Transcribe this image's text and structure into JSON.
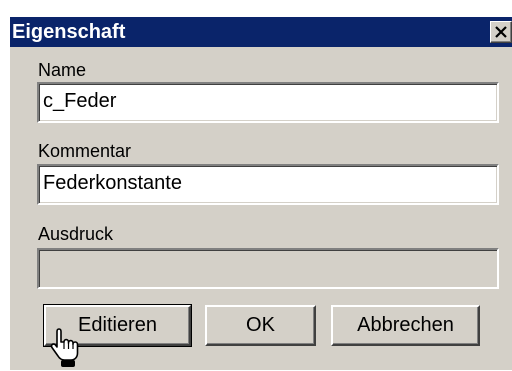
{
  "dialog": {
    "title": "Eigenschaft",
    "close_icon": "close-icon"
  },
  "fields": {
    "name_label": "Name",
    "name_value": "c_Feder",
    "comment_label": "Kommentar",
    "comment_value": "Federkonstante",
    "expression_label": "Ausdruck",
    "expression_value": ""
  },
  "buttons": {
    "edit_label": "Editieren",
    "ok_label": "OK",
    "cancel_label": "Abbrechen"
  },
  "cursor": {
    "icon": "hand-pointer-icon"
  }
}
